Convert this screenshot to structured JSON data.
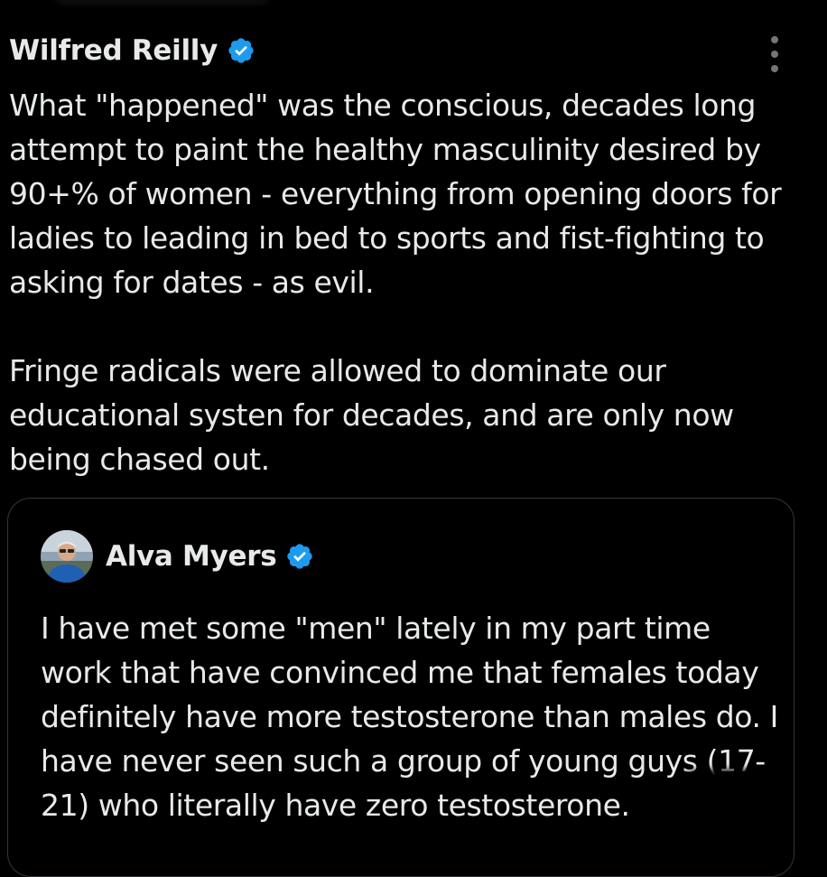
{
  "colors": {
    "background": "#000000",
    "text_primary": "#e7e9ea",
    "verified_blue": "#1d9bf0",
    "border": "#333639",
    "icon_gray": "#71767b"
  },
  "tweet": {
    "author": "Wilfred Reilly",
    "verified_icon": "verified-badge-icon",
    "more_icon": "more-options-icon",
    "paragraphs": [
      "What \"happened\" was the conscious, decades long attempt to paint the healthy masculinity desired by 90+% of women - everything from opening doors for ladies to leading in bed to sports and fist-fighting to asking for dates - as evil.",
      "Fringe radicals were allowed to dominate our educational systen for decades, and are only now being chased out."
    ]
  },
  "quote": {
    "author": "Alva Myers",
    "verified_icon": "verified-badge-icon",
    "avatar_icon": "profile-photo",
    "text": "I have met some \"men\" lately in my part time work that have convinced me that females today definitely have more testosterone than males do. I have never seen such a group of young guys (17-21) who literally have zero testosterone."
  }
}
